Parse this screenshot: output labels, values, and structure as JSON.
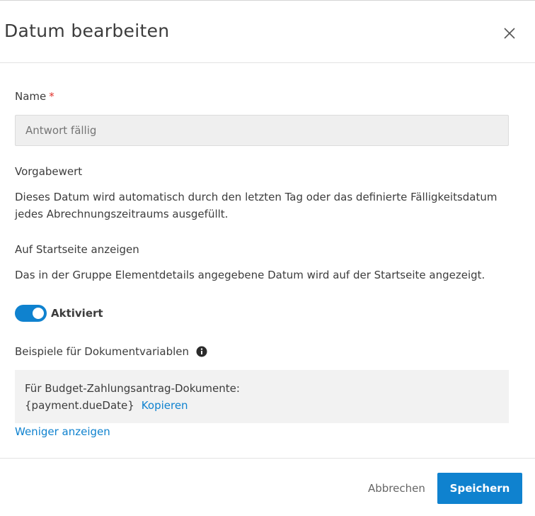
{
  "dialog": {
    "title": "Datum bearbeiten",
    "close_icon": "close-icon"
  },
  "name_field": {
    "label": "Name",
    "required_mark": "*",
    "placeholder": "Antwort fällig"
  },
  "default_value": {
    "label": "Vorgabewert",
    "description": "Dieses Datum wird automatisch durch den letzten Tag oder das definierte Fälligkeitsdatum jedes Abrechnungszeitraums ausgefüllt."
  },
  "homepage": {
    "label": "Auf Startseite anzeigen",
    "description": "Das in der Gruppe Elementdetails angegebene Datum wird auf der Startseite angezeigt.",
    "toggle_label": "Aktiviert",
    "toggle_on": true
  },
  "examples": {
    "label": "Beispiele für Dokumentvariablen",
    "info_icon": "info-icon",
    "line1": "Für Budget-Zahlungsantrag-Dokumente:",
    "variable": "{payment.dueDate}",
    "copy_label": "Kopieren",
    "show_less": "Weniger anzeigen"
  },
  "footer": {
    "cancel_label": "Abbrechen",
    "save_label": "Speichern"
  },
  "colors": {
    "accent": "#0f82cf",
    "required": "#e0312b",
    "input_bg": "#efefef",
    "example_bg": "#f2f2f2"
  }
}
